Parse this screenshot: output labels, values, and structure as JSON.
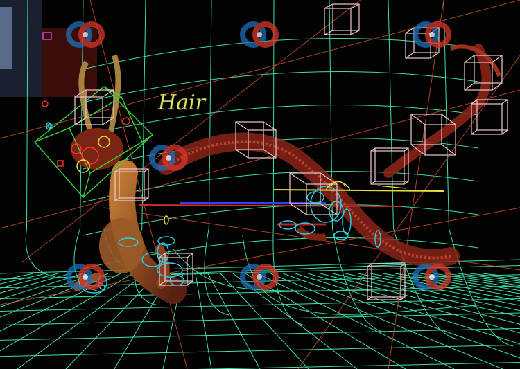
{
  "viewport": {
    "name": "3d-perspective-viewport",
    "background": "#020202",
    "grid_color": "#3fe0a8",
    "wire_color": "#c24a2a",
    "box_color": "#f0c8cc"
  },
  "scene": {
    "hair_label": "Hair",
    "hair_label_color": "#e6e86a",
    "dragon_color": "#8a2418",
    "dragon_belly_color": "#b8702c",
    "control_colors": {
      "cyan": "#2ad0e8",
      "green": "#38d838",
      "red": "#ff3030",
      "yellow": "#e8e040",
      "blue": "#3040ff"
    }
  },
  "watermark": {
    "icon_name": "logo-watermark-icon",
    "colors": [
      "#1e6fb8",
      "#d8362a"
    ]
  }
}
